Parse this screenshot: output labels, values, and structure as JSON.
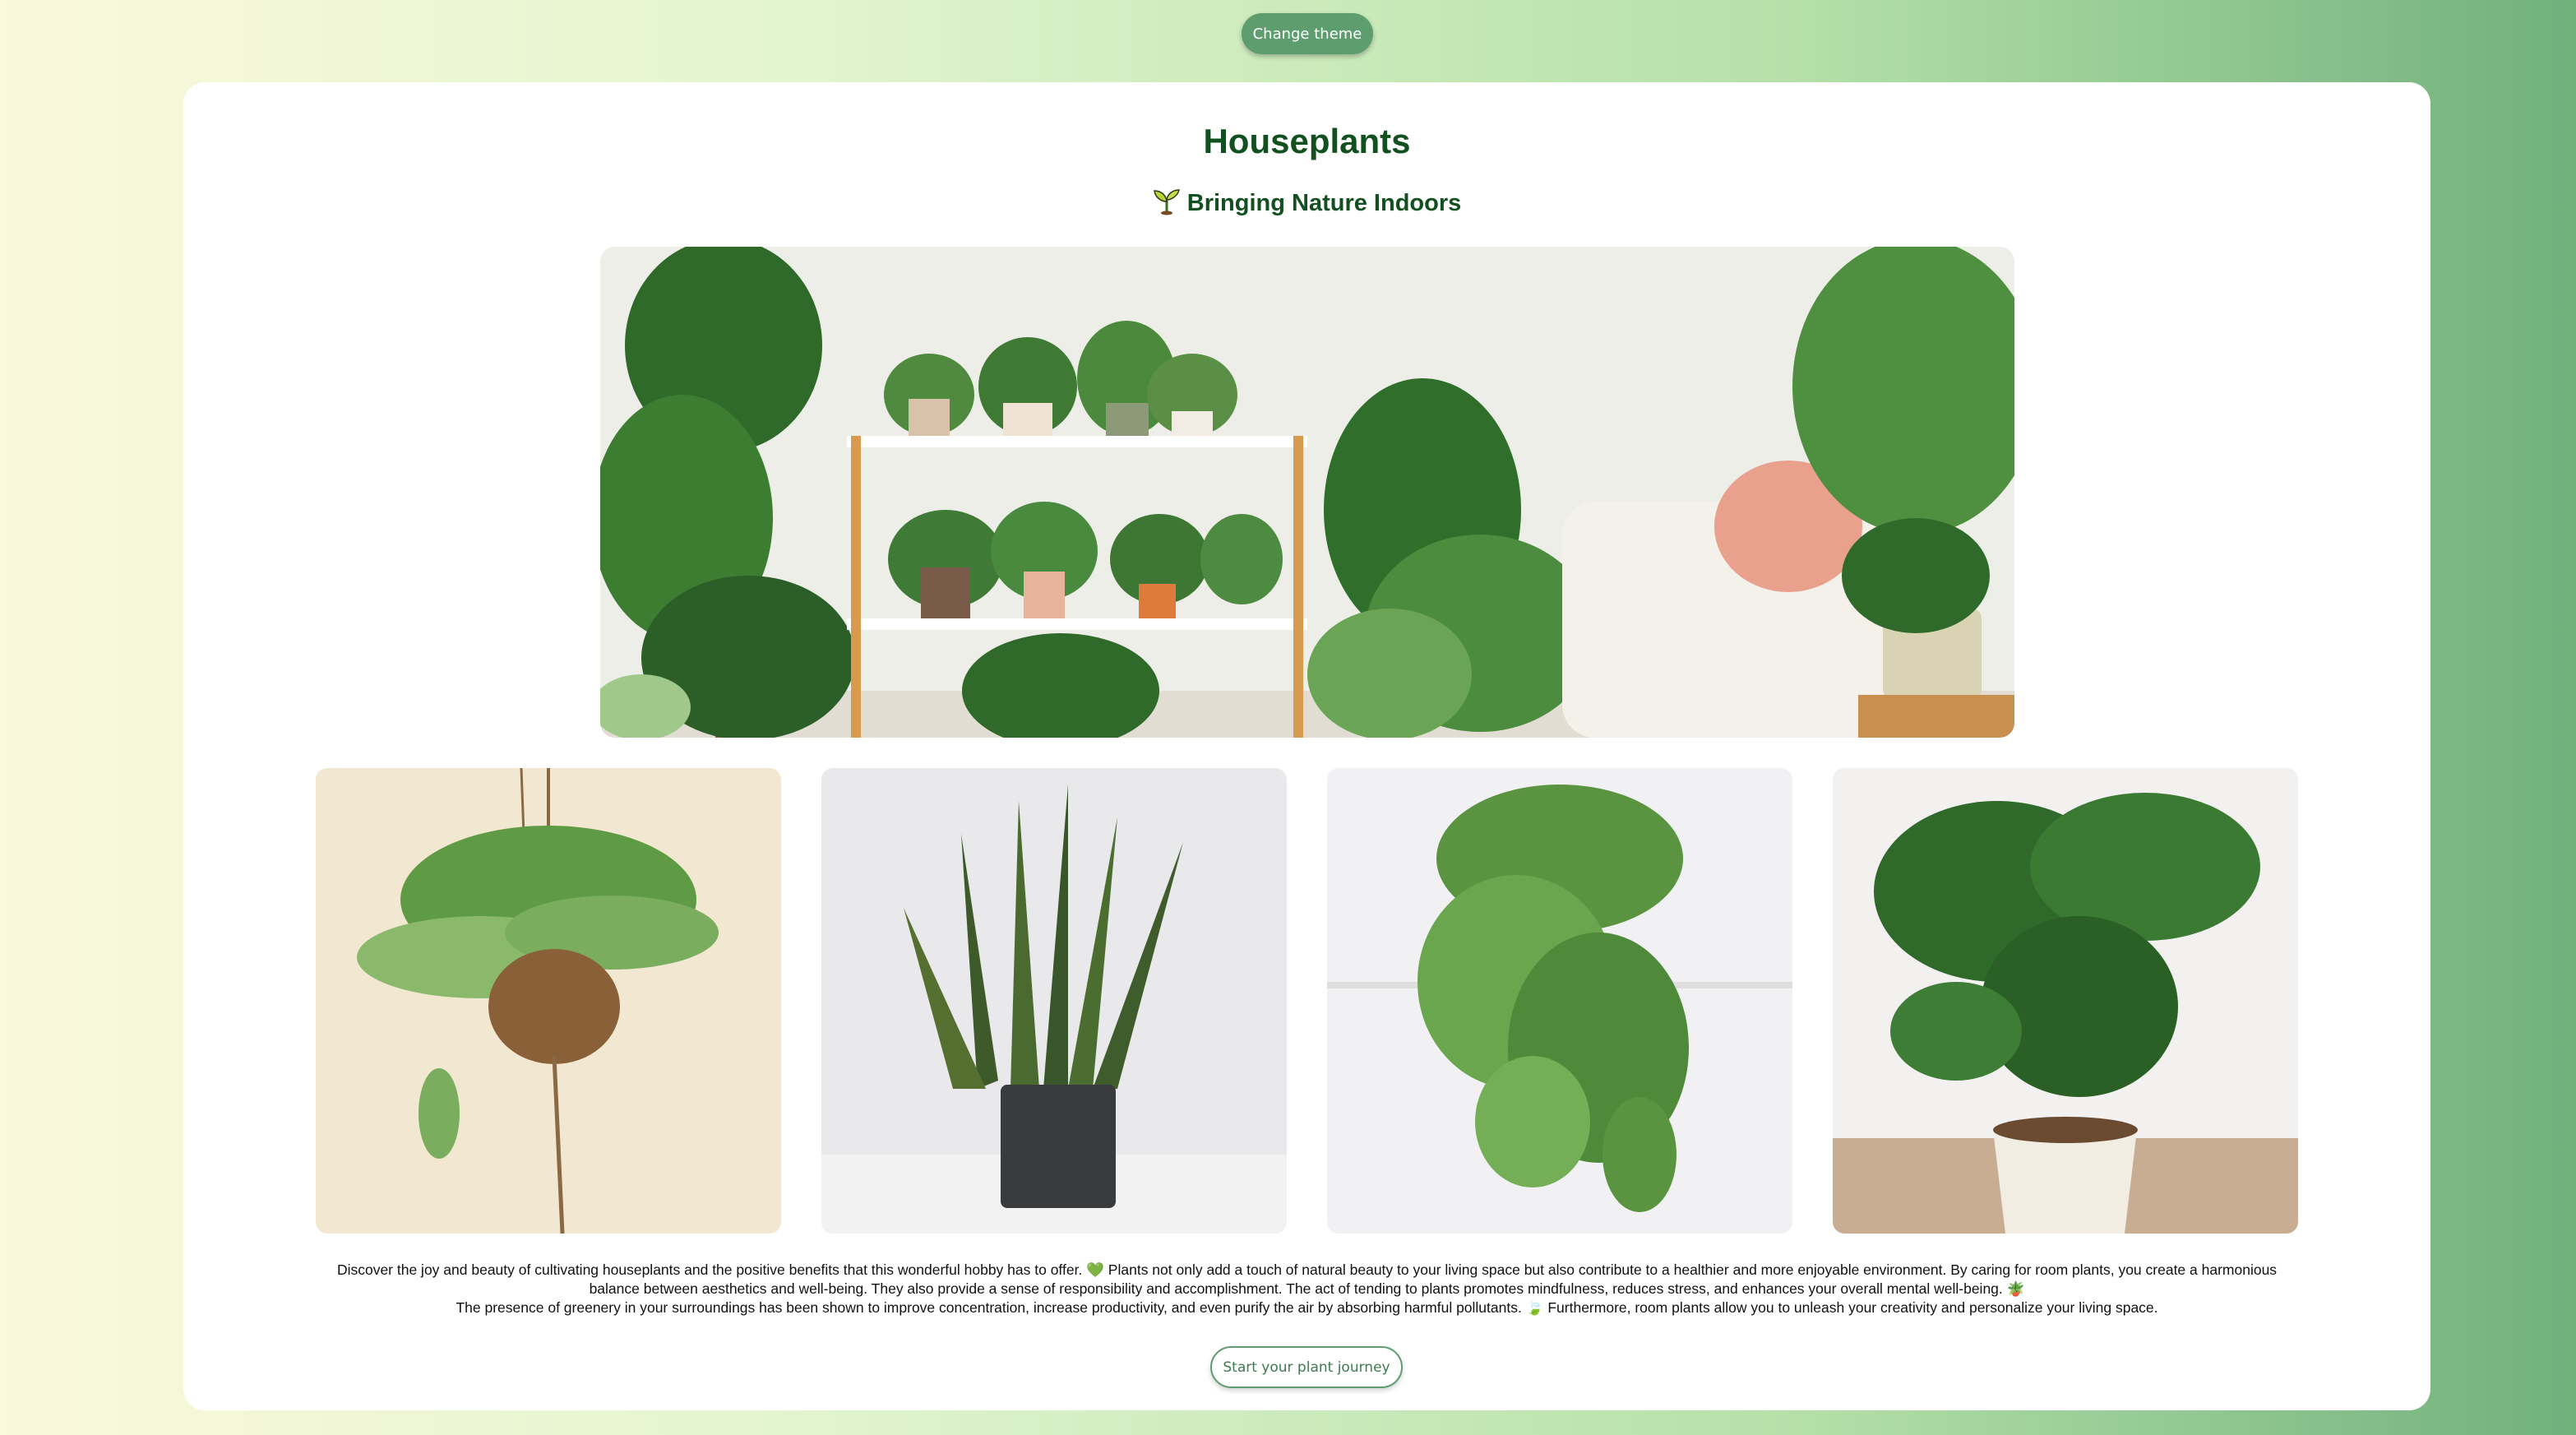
{
  "header": {
    "theme_button": "Change theme"
  },
  "main": {
    "title": "Houseplants",
    "subtitle": "Bringing Nature Indoors",
    "subtitle_icon": "sprout-icon",
    "description": {
      "line1": "Discover the joy and beauty of cultivating houseplants and the positive benefits that this wonderful hobby has to offer. 💚 Plants not only add a touch of natural beauty to your living space but also contribute to a healthier and more enjoyable environment. By caring for room plants, you create a harmonious balance between aesthetics and well-being. They also provide a sense of responsibility and accomplishment. The act of tending to plants promotes mindfulness, reduces stress, and enhances your overall mental well-being. 🪴",
      "line2": "The presence of greenery in your surroundings has been shown to improve concentration, increase productivity, and even purify the air by absorbing harmful pollutants. 🍃 Furthermore, room plants allow you to unleash your creativity and personalize your living space."
    },
    "cta_button": "Start your plant journey"
  },
  "images": {
    "hero": "houseplants-shelf-photo",
    "thumbs": [
      "spider-plant-photo",
      "snake-plant-photo",
      "pothos-photo",
      "monstera-photo"
    ]
  },
  "colors": {
    "accent": "#5e9d6d",
    "heading": "#12501f",
    "card": "#ffffff"
  }
}
